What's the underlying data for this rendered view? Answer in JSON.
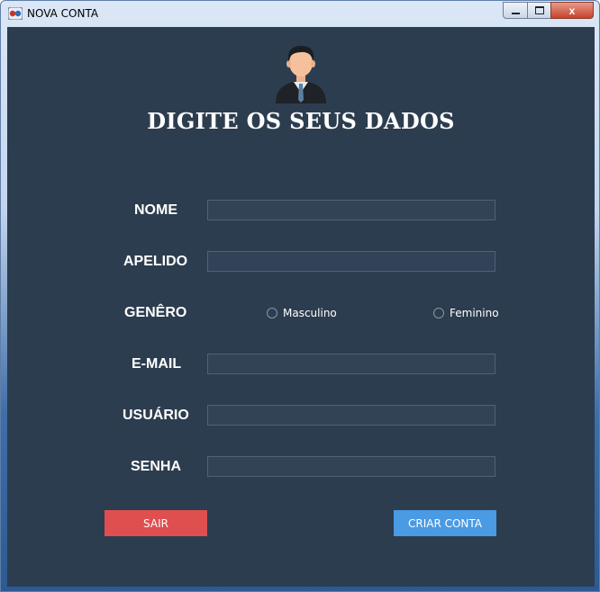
{
  "window": {
    "title": "NOVA CONTA"
  },
  "titlebar_buttons": {
    "close_glyph": "x"
  },
  "form": {
    "heading": "DIGITE OS SEUS DADOS",
    "fields": [
      {
        "label": "NOME",
        "value": ""
      },
      {
        "label": "APELIDO",
        "value": ""
      },
      {
        "label": "E-MAIL",
        "value": ""
      },
      {
        "label": "USUÁRIO",
        "value": ""
      },
      {
        "label": "SENHA",
        "value": ""
      }
    ],
    "gender": {
      "label": "GENÊRO",
      "options": [
        "Masculino",
        "Feminino"
      ],
      "selected": null
    }
  },
  "actions": {
    "exit_label": "SAIR",
    "create_label": "CRIAR CONTA"
  },
  "colors": {
    "background": "#2c3d4f",
    "field_bg": "#334357",
    "exit_button": "#df4f4f",
    "create_button": "#4a9ae4"
  },
  "icons": {
    "window": "app-icon",
    "avatar": "businessman-avatar-icon"
  }
}
